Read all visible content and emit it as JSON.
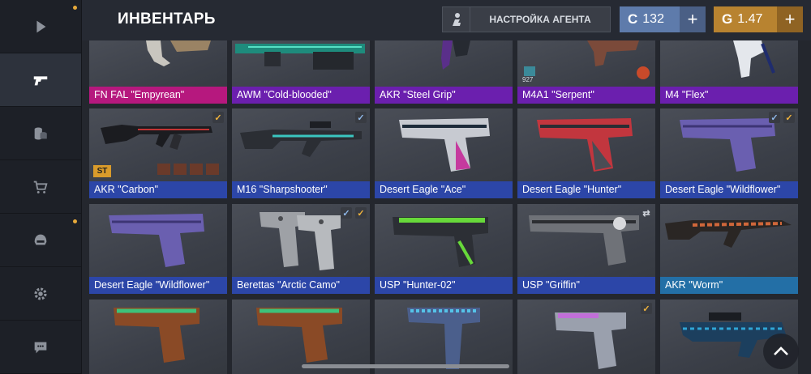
{
  "header": {
    "title": "ИНВЕНТАРЬ",
    "agent_button": "НАСТРОЙКА АГЕНТА",
    "silver": {
      "icon": "C",
      "value": "132",
      "add": "+"
    },
    "gold": {
      "icon": "G",
      "value": "1.47",
      "add": "+"
    }
  },
  "sidebar": {
    "items": [
      {
        "icon": "play-icon"
      },
      {
        "icon": "pistol-icon"
      },
      {
        "icon": "coins-icon"
      },
      {
        "icon": "cart-icon"
      },
      {
        "icon": "helmet-icon"
      },
      {
        "icon": "gear-icon"
      },
      {
        "icon": "chat-icon"
      }
    ]
  },
  "inventory": {
    "rows": [
      [
        {
          "label": "FN FAL \"Empyrean\"",
          "rarity": "pink"
        },
        {
          "label": "AWM \"Cold-blooded\"",
          "rarity": "purple"
        },
        {
          "label": "AKR \"Steel Grip\"",
          "rarity": "purple"
        },
        {
          "label": "M4A1 \"Serpent\"",
          "rarity": "purple",
          "counter": "927"
        },
        {
          "label": "M4 \"Flex\"",
          "rarity": "purple"
        }
      ],
      [
        {
          "label": "AKR \"Carbon\"",
          "rarity": "blue",
          "badge": "ST"
        },
        {
          "label": "M16 \"Sharpshooter\"",
          "rarity": "blue"
        },
        {
          "label": "Desert Eagle \"Ace\"",
          "rarity": "blue"
        },
        {
          "label": "Desert Eagle \"Hunter\"",
          "rarity": "blue"
        },
        {
          "label": "Desert Eagle \"Wildflower\"",
          "rarity": "blue"
        }
      ],
      [
        {
          "label": "Desert Eagle \"Wildflower\"",
          "rarity": "blue"
        },
        {
          "label": "Berettas \"Arctic Camo\"",
          "rarity": "blue"
        },
        {
          "label": "USP \"Hunter-02\"",
          "rarity": "blue"
        },
        {
          "label": "USP \"Griffin\"",
          "rarity": "blue"
        },
        {
          "label": "AKR \"Worm\"",
          "rarity": "teal"
        }
      ]
    ]
  },
  "colors": {
    "accent_gold": "#f0b33c",
    "silver": "#5e7bab",
    "gold": "#b88330"
  }
}
